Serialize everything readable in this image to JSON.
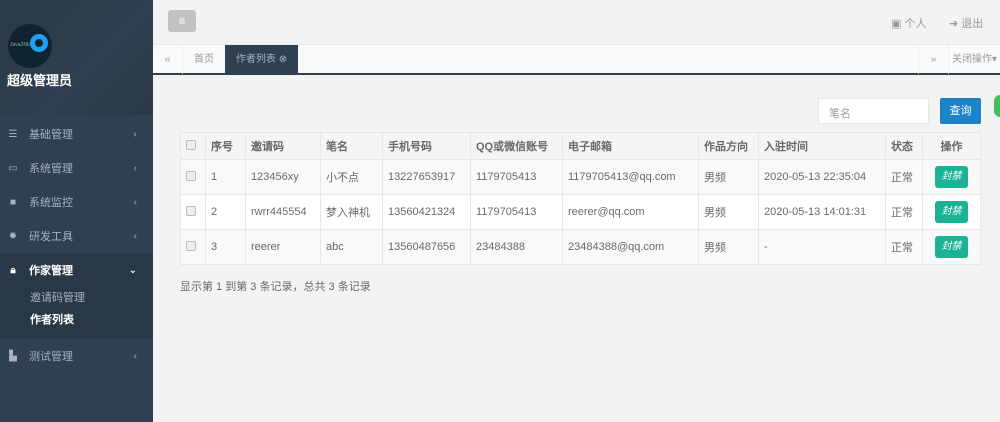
{
  "sidebar": {
    "logo_text": "Java2Nb",
    "user": "超级管理员",
    "items": [
      {
        "label": "基础管理",
        "icon": "bars-icon"
      },
      {
        "label": "系统管理",
        "icon": "desktop-icon"
      },
      {
        "label": "系统监控",
        "icon": "video-icon"
      },
      {
        "label": "研发工具",
        "icon": "gear-icon"
      },
      {
        "label": "作家管理",
        "icon": "lock-icon"
      },
      {
        "label": "测试管理",
        "icon": "bath-icon"
      }
    ],
    "sub": [
      "邀请码管理",
      "作者列表"
    ]
  },
  "topbar": {
    "menu_icon": "≡",
    "profile": "个人",
    "logout": "退出"
  },
  "tabs": {
    "home": "首页",
    "current": "作者列表",
    "close_ops": "关闭操作"
  },
  "search": {
    "placeholder": "笔名",
    "button": "查询"
  },
  "table": {
    "headers": [
      "序号",
      "邀请码",
      "笔名",
      "手机号码",
      "QQ或微信账号",
      "电子邮箱",
      "作品方向",
      "入驻时间",
      "状态",
      "操作"
    ],
    "rows": [
      [
        "1",
        "123456xy",
        "小不点",
        "13227653917",
        "1179705413",
        "1179705413@qq.com",
        "男频",
        "2020-05-13 22:35:04",
        "正常"
      ],
      [
        "2",
        "rwrr445554",
        "梦入神机",
        "13560421324",
        "1179705413",
        "reerer@qq.com",
        "男频",
        "2020-05-13 14:01:31",
        "正常"
      ],
      [
        "3",
        "reerer",
        "abc",
        "13560487656",
        "23484388",
        "23484388@qq.com",
        "男频",
        "-",
        "正常"
      ]
    ],
    "action": "封禁"
  },
  "footer": "显示第 1 到第 3 条记录，总共 3 条记录"
}
